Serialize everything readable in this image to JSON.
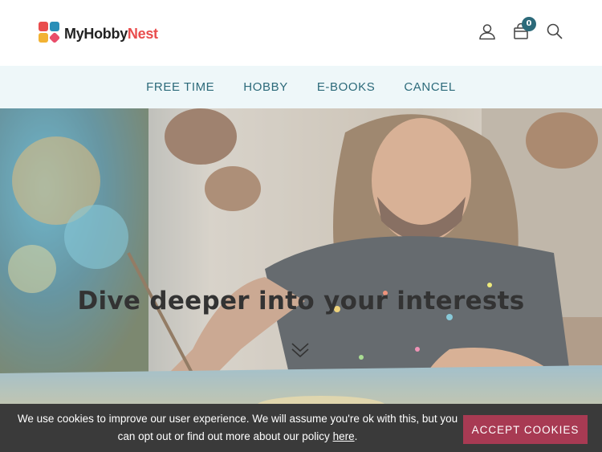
{
  "logo": {
    "brand_dark": "MyHobby",
    "brand_accent": "Nest",
    "accent_color": "#e94d4d"
  },
  "header": {
    "icons": [
      "user-icon",
      "bag-icon",
      "search-icon"
    ],
    "cart_count": "0",
    "badge_color": "#2c6a7a"
  },
  "nav": {
    "items": [
      {
        "label": "FREE TIME"
      },
      {
        "label": "HOBBY"
      },
      {
        "label": "E-BOOKS"
      },
      {
        "label": "CANCEL"
      }
    ],
    "text_color": "#2c6a7a",
    "background": "#eef7f9"
  },
  "hero": {
    "title": "Dive deeper into your interests",
    "icon": "double-chevron-down-icon"
  },
  "cookie": {
    "text_before": "We use cookies to improve our user experience. We will assume you're ok with this, but you can opt out or find out more about our policy ",
    "link_text": "here",
    "text_after": ".",
    "button_label": "ACCEPT COOKIES",
    "button_color": "#a83a53"
  }
}
